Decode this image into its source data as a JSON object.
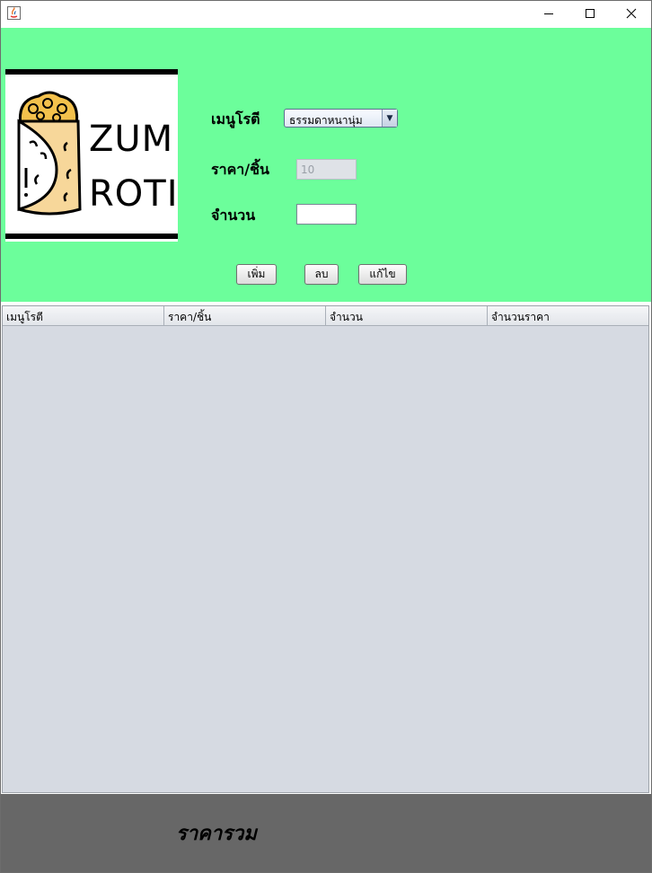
{
  "window": {
    "minimize_glyph": "—",
    "maximize_glyph": "☐",
    "close_glyph": "✕"
  },
  "logo": {
    "line1": "ZUM",
    "line2": "ROTI"
  },
  "form": {
    "menu_label": "เมนูโรตี",
    "menu_selected": "ธรรมดาหนานุ่ม",
    "price_label": "ราคา/ชิ้น",
    "price_value": "10",
    "qty_label": "จำนวน",
    "qty_value": ""
  },
  "buttons": {
    "add": "เพิ่ม",
    "delete": "ลบ",
    "edit": "แก้ไข"
  },
  "table": {
    "columns": [
      "เมนูโรตี",
      "ราคา/ชิ้น",
      "จำนวน",
      "จำนวนราคา"
    ]
  },
  "footer": {
    "total_label": "ราคารวม"
  },
  "colors": {
    "accent_green": "#6cfe9b",
    "footer_gray": "#676767",
    "table_bg": "#d6dae2"
  }
}
